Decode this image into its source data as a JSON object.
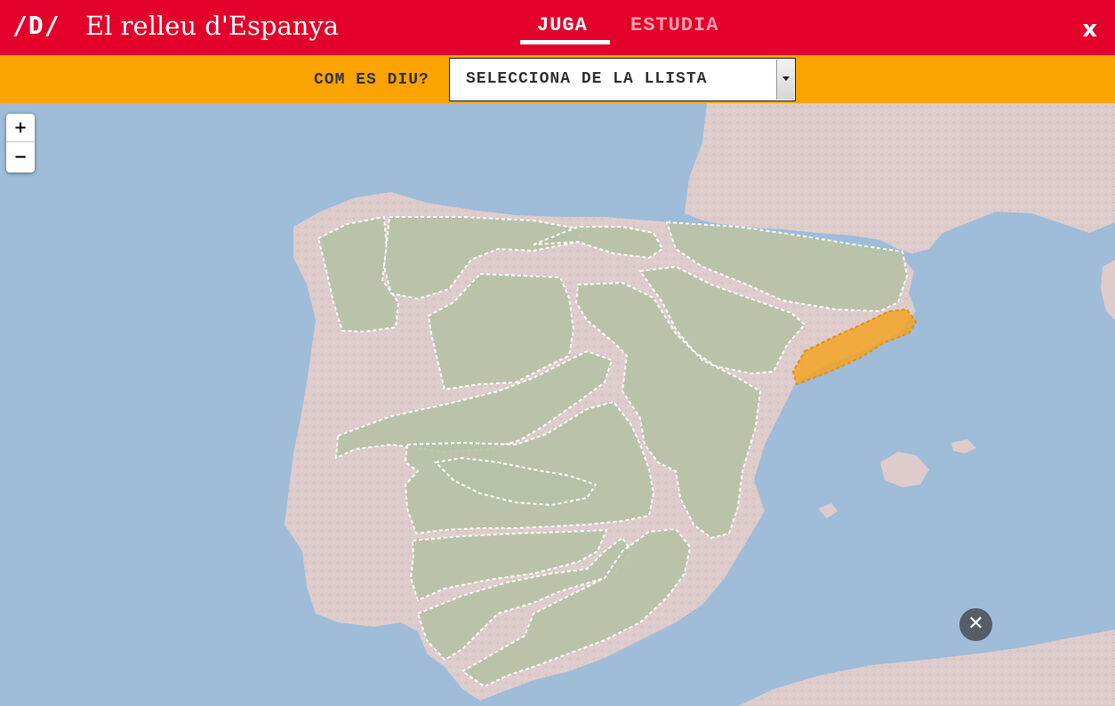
{
  "header": {
    "logo": "/D/",
    "title": "El relleu d'Espanya",
    "tabs": [
      {
        "label": "JUGA",
        "active": true
      },
      {
        "label": "ESTUDIA",
        "active": false
      }
    ],
    "close_label": "x"
  },
  "question": {
    "label": "COM ES DIU?",
    "select_value": "SELECCIONA DE LA LLISTA"
  },
  "map": {
    "zoom_in": "+",
    "zoom_out": "−",
    "close_label": "✕",
    "colors": {
      "sea": "#9fbcd9",
      "land": "#ddcccb",
      "region_fill": "#b6c2a6",
      "region_border": "#ffffff",
      "highlight_fill": "#f3a325"
    },
    "regions_count": 14,
    "highlighted_region_state": "selected"
  }
}
